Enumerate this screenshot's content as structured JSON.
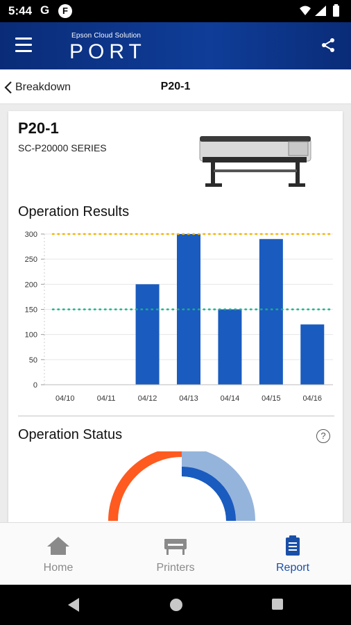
{
  "status_bar": {
    "time": "5:44",
    "g_label": "G",
    "f_label": "F"
  },
  "header": {
    "brand_sub": "Epson Cloud Solution",
    "brand_main": "PORT"
  },
  "nav": {
    "back_label": "Breakdown",
    "title": "P20-1"
  },
  "printer": {
    "name": "P20-1",
    "model": "SC-P20000 SERIES"
  },
  "operation_results": {
    "title": "Operation Results"
  },
  "operation_status": {
    "title": "Operation Status",
    "help_label": "?"
  },
  "colors": {
    "bar": "#1a5bbf",
    "brand": "#0f3d98",
    "orange_line": "#f5b400",
    "green_line": "#17b08a",
    "donut_orange": "#ff5a1f",
    "donut_blue": "#1a5bbf",
    "donut_light_blue": "#8fb0da",
    "active_tab": "#1a4fa8"
  },
  "chart_data": {
    "type": "bar",
    "categories": [
      "04/10",
      "04/11",
      "04/12",
      "04/13",
      "04/14",
      "04/15",
      "04/16"
    ],
    "values": [
      0,
      0,
      200,
      300,
      150,
      290,
      120
    ],
    "ylim": [
      0,
      300
    ],
    "yticks": [
      0,
      50,
      100,
      150,
      200,
      250,
      300
    ],
    "reference_lines": [
      300,
      150
    ],
    "grid": true
  },
  "bottom_nav": {
    "items": [
      {
        "label": "Home",
        "icon": "home-icon",
        "active": false
      },
      {
        "label": "Printers",
        "icon": "printer-icon",
        "active": false
      },
      {
        "label": "Report",
        "icon": "clipboard-icon",
        "active": true
      }
    ]
  }
}
